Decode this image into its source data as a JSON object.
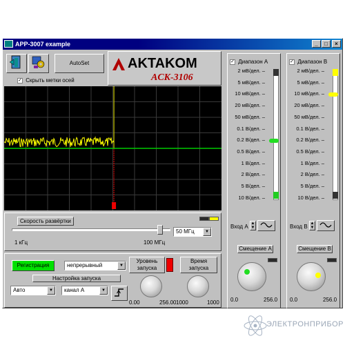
{
  "window": {
    "title": "APP-3007 example",
    "controls": [
      "_",
      "□",
      "×"
    ]
  },
  "logo": {
    "brand": "AKTAKOM",
    "model": "ACK-3106"
  },
  "toolbar": {
    "autoset_label": "AutoSet"
  },
  "hide_axis": {
    "label": "Скрыть метки осей",
    "checked": true
  },
  "sweep": {
    "label": "Скорость развёртки",
    "min_label": "1 кГц",
    "max_label": "100 МГц",
    "value": "50 МГц",
    "slider_fraction": 0.95
  },
  "trigger": {
    "registration_label": "Регистрация",
    "mode_value": "непрерывный",
    "setup_label": "Настройка запуска",
    "source_mode": "Авто",
    "channel": "канал А",
    "level_label": "Уровень\nзапуска",
    "time_label": "Время\nзапуска",
    "level_min": "0.00",
    "level_max": "256.00",
    "time_min": "1000",
    "time_max": "1000"
  },
  "channel_a": {
    "range_label": "Диапазон А",
    "checked": true,
    "ranges": [
      "2 мВ/дел.",
      "5 мВ/дел.",
      "10 мВ/дел.",
      "20 мВ/дел.",
      "50 мВ/дел.",
      "0.1 В/дел.",
      "0.2 В/дел.",
      "0.5 В/дел.",
      "1 В/дел.",
      "2 В/дел.",
      "5 В/дел.",
      "10 В/дел."
    ],
    "selected_index": 6,
    "input_label": "Вход А",
    "offset_label": "Смещение А",
    "offset_min": "0.0",
    "offset_max": "256.0",
    "marker_color": "#22dd22"
  },
  "channel_b": {
    "range_label": "Диапазон В",
    "checked": true,
    "ranges": [
      "2 мВ/дел.",
      "5 мВ/дел.",
      "10 мВ/дел.",
      "20 мВ/дел.",
      "50 мВ/дел.",
      "0.1 В/дел.",
      "0.2 В/дел.",
      "0.5 В/дел.",
      "1 В/дел.",
      "2 В/дел.",
      "5 В/дел.",
      "10 В/дел."
    ],
    "selected_index": 2,
    "input_label": "Вход В",
    "offset_label": "Смещение В",
    "offset_min": "0.0",
    "offset_max": "256.0",
    "marker_color": "#ffff00"
  },
  "footer": {
    "watermark": "ЭЛЕКТРОНПРИБОР"
  },
  "colors": {
    "trace_a": "#ffff00",
    "trace_b": "#00cc00",
    "trigger_line": "#cc0000",
    "registration_bg": "#00e000"
  }
}
